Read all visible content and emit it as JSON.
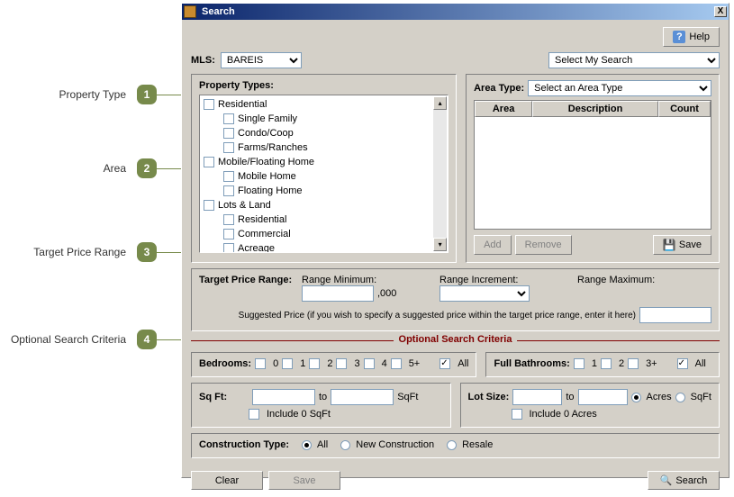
{
  "annotations": {
    "a1_label": "Property Type",
    "a1_num": "1",
    "a2_label": "Area",
    "a2_num": "2",
    "a3_label": "Target Price Range",
    "a3_num": "3",
    "a4_label": "Optional Search Criteria",
    "a4_num": "4"
  },
  "window": {
    "title": "Search",
    "close_x": "X"
  },
  "help_label": "Help",
  "mls": {
    "label": "MLS:",
    "value": "BAREIS"
  },
  "select_my_search": "Select My Search",
  "property_types": {
    "heading": "Property Types:",
    "items": {
      "residential": "Residential",
      "single_family": "Single Family",
      "condo_coop": "Condo/Coop",
      "farms": "Farms/Ranches",
      "mobile_floating": "Mobile/Floating Home",
      "mobile_home": "Mobile Home",
      "floating_home": "Floating Home",
      "lots_land": "Lots & Land",
      "res2": "Residential",
      "commercial": "Commercial",
      "acreage": "Acreage"
    },
    "up": "▴",
    "down": "▾"
  },
  "area": {
    "type_label": "Area Type:",
    "type_placeholder": "Select an Area Type",
    "col_area": "Area",
    "col_desc": "Description",
    "col_count": "Count",
    "add": "Add",
    "remove": "Remove",
    "save": "Save"
  },
  "tpr": {
    "heading": "Target Price Range:",
    "min": "Range Minimum:",
    "inc": "Range Increment:",
    "max": "Range Maximum:",
    "thousands": ",000",
    "suggested": "Suggested Price (if you wish to specify a suggested price within the target price range, enter it here)"
  },
  "optional_heading": "Optional Search Criteria",
  "bedrooms": {
    "label": "Bedrooms:",
    "o0": "0",
    "o1": "1",
    "o2": "2",
    "o3": "3",
    "o4": "4",
    "o5": "5+",
    "all": "All"
  },
  "baths": {
    "label": "Full Bathrooms:",
    "o1": "1",
    "o2": "2",
    "o3": "3+",
    "all": "All"
  },
  "sqft": {
    "label": "Sq Ft:",
    "to": "to",
    "unit": "SqFt",
    "include0": "Include 0 SqFt"
  },
  "lotsize": {
    "label": "Lot Size:",
    "to": "to",
    "acres": "Acres",
    "sqft": "SqFt",
    "include0": "Include 0 Acres"
  },
  "construction": {
    "label": "Construction Type:",
    "all": "All",
    "new": "New Construction",
    "resale": "Resale"
  },
  "footer": {
    "clear": "Clear",
    "save": "Save",
    "search": "Search"
  }
}
